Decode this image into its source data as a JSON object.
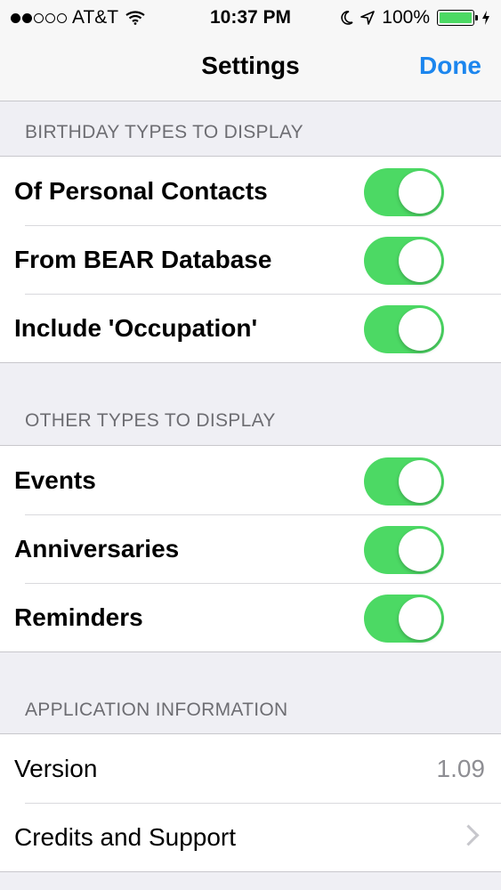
{
  "status_bar": {
    "signal_filled": 2,
    "signal_total": 5,
    "carrier": "AT&T",
    "time": "10:37 PM",
    "battery_percent": "100%",
    "battery_level": 1.0,
    "battery_color": "#4cd964"
  },
  "nav": {
    "title": "Settings",
    "done_label": "Done",
    "done_color": "#1c86ee"
  },
  "sections": {
    "birthday": {
      "header": "BIRTHDAY TYPES TO DISPLAY",
      "rows": [
        {
          "label": "Of Personal Contacts",
          "on": true
        },
        {
          "label": "From BEAR Database",
          "on": true
        },
        {
          "label": "Include 'Occupation'",
          "on": true
        }
      ]
    },
    "other": {
      "header": "OTHER TYPES TO DISPLAY",
      "rows": [
        {
          "label": "Events",
          "on": true
        },
        {
          "label": "Anniversaries",
          "on": true
        },
        {
          "label": "Reminders",
          "on": true
        }
      ]
    },
    "app_info": {
      "header": "APPLICATION INFORMATION",
      "version_label": "Version",
      "version_value": "1.09",
      "credits_label": "Credits and Support"
    }
  },
  "colors": {
    "toggle_on": "#4cd964",
    "background": "#efeff4",
    "section_text": "#6d6d72"
  }
}
